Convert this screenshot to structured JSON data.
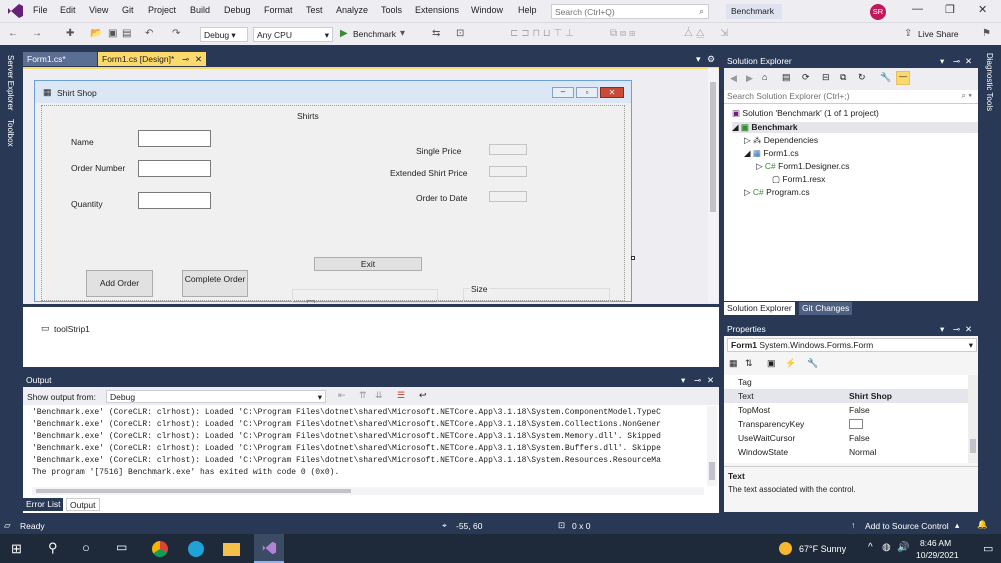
{
  "menubar": {
    "items": [
      "File",
      "Edit",
      "View",
      "Git",
      "Project",
      "Build",
      "Debug",
      "Format",
      "Test",
      "Analyze",
      "Tools",
      "Extensions",
      "Window",
      "Help"
    ],
    "search_placeholder": "Search (Ctrl+Q)",
    "solution_badge": "Benchmark",
    "avatar_initials": "SR"
  },
  "toolbar": {
    "config": "Debug",
    "platform": "Any CPU",
    "run_label": "Benchmark",
    "live_share": "Live Share"
  },
  "left_rail": {
    "server_explorer": "Server Explorer",
    "toolbox": "Toolbox"
  },
  "right_rail": {
    "diagnostic_tools": "Diagnostic Tools"
  },
  "doc_tabs": [
    {
      "label": "Form1.cs*"
    },
    {
      "label": "Form1.cs [Design]*"
    }
  ],
  "form": {
    "title": "Shirt Shop",
    "groupbox_title": "Shirts",
    "labels": {
      "name": "Name",
      "order_number": "Order Number",
      "quantity": "Quantity",
      "single_price": "Single Price",
      "extended_price": "Extended Shirt Price",
      "order_to_date": "Order to Date",
      "size": "Size"
    },
    "buttons": {
      "exit": "Exit",
      "add_order": "Add Order",
      "complete_order": "Complete Order"
    }
  },
  "tray": {
    "toolstrip": "toolStrip1"
  },
  "output": {
    "title": "Output",
    "show_from_label": "Show output from:",
    "source": "Debug",
    "lines": [
      "'Benchmark.exe' (CoreCLR: clrhost): Loaded 'C:\\Program Files\\dotnet\\shared\\Microsoft.NETCore.App\\3.1.18\\System.ComponentModel.TypeC",
      "'Benchmark.exe' (CoreCLR: clrhost): Loaded 'C:\\Program Files\\dotnet\\shared\\Microsoft.NETCore.App\\3.1.18\\System.Collections.NonGener",
      "'Benchmark.exe' (CoreCLR: clrhost): Loaded 'C:\\Program Files\\dotnet\\shared\\Microsoft.NETCore.App\\3.1.18\\System.Memory.dll'. Skipped",
      "'Benchmark.exe' (CoreCLR: clrhost): Loaded 'C:\\Program Files\\dotnet\\shared\\Microsoft.NETCore.App\\3.1.18\\System.Buffers.dll'. Skippe",
      "'Benchmark.exe' (CoreCLR: clrhost): Loaded 'C:\\Program Files\\dotnet\\shared\\Microsoft.NETCore.App\\3.1.18\\System.Resources.ResourceMa",
      "The program '[7516] Benchmark.exe' has exited with code 0 (0x0)."
    ],
    "tabs": [
      "Error List",
      "Output"
    ]
  },
  "solution_explorer": {
    "title": "Solution Explorer",
    "search_placeholder": "Search Solution Explorer (Ctrl+;)",
    "items": [
      "Solution 'Benchmark' (1 of 1 project)",
      "Benchmark",
      "Dependencies",
      "Form1.cs",
      "Form1.Designer.cs",
      "Form1.resx",
      "Program.cs"
    ],
    "tabs": [
      "Solution Explorer",
      "Git Changes"
    ]
  },
  "properties": {
    "title": "Properties",
    "object": "Form1",
    "object_type": "System.Windows.Forms.Form",
    "rows": [
      {
        "key": "Tag",
        "value": ""
      },
      {
        "key": "Text",
        "value": "Shirt Shop"
      },
      {
        "key": "TopMost",
        "value": "False"
      },
      {
        "key": "TransparencyKey",
        "value": ""
      },
      {
        "key": "UseWaitCursor",
        "value": "False"
      },
      {
        "key": "WindowState",
        "value": "Normal"
      }
    ],
    "desc_title": "Text",
    "desc_text": "The text associated with the control."
  },
  "statusbar": {
    "ready": "Ready",
    "position": "-55, 60",
    "size": "0 x 0",
    "source_control": "Add to Source Control"
  },
  "taskbar": {
    "weather": "67°F  Sunny",
    "time": "8:46 AM",
    "date": "10/29/2021"
  },
  "colors": {
    "accent": "#68217a",
    "vs_blue": "#293955",
    "tab_active": "#fcd96d"
  }
}
